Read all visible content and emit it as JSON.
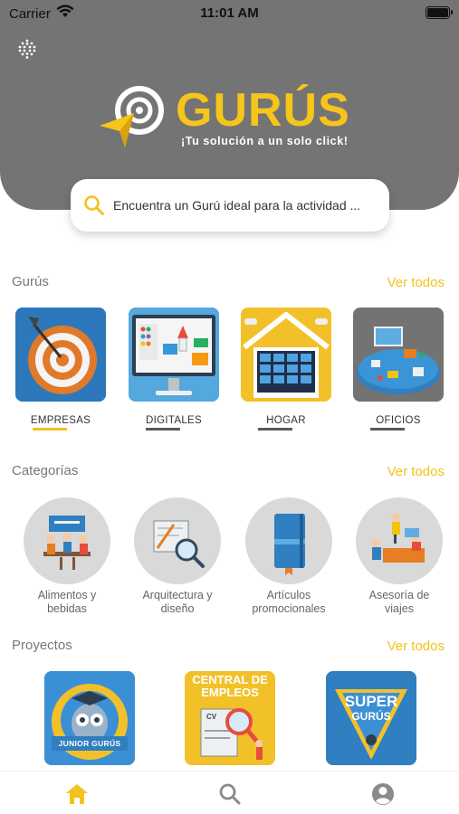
{
  "status_bar": {
    "carrier": "Carrier",
    "time": "11:01 AM"
  },
  "brand": {
    "name": "GURÚS",
    "tagline": "¡Tu solución a un solo click!"
  },
  "search": {
    "placeholder": "Encuentra un Gurú ideal para la actividad ..."
  },
  "sections": {
    "gurus": {
      "title": "Gurús",
      "see_all": "Ver todos"
    },
    "categories": {
      "title": "Categorías",
      "see_all": "Ver todos"
    },
    "projects": {
      "title": "Proyectos",
      "see_all": "Ver todos"
    }
  },
  "gurus": [
    {
      "label": "EMPRESAS",
      "selected": true
    },
    {
      "label": "DIGITALES",
      "selected": false
    },
    {
      "label": "HOGAR",
      "selected": false
    },
    {
      "label": "OFICIOS",
      "selected": false
    }
  ],
  "categories": [
    {
      "line1": "Alimentos y",
      "line2": "bebidas"
    },
    {
      "line1": "Arquitectura y",
      "line2": "diseño"
    },
    {
      "line1": "Artículos",
      "line2": "promocionales"
    },
    {
      "line1": "Asesoría de",
      "line2": "viajes"
    }
  ],
  "projects": [
    {
      "caption": "JUNIOR GURÚS"
    },
    {
      "title_line1": "CENTRAL DE",
      "title_line2": "EMPLEOS",
      "doc": "CV"
    },
    {
      "title_line1": "SUPER",
      "title_line2": "GURÚS"
    }
  ],
  "tab_bar": {
    "items": [
      {
        "icon": "home-icon",
        "active": true
      },
      {
        "icon": "search-icon",
        "active": false
      },
      {
        "icon": "profile-icon",
        "active": false
      }
    ]
  },
  "colors": {
    "accent": "#f3c21c",
    "header_gray": "#747474",
    "tab_inactive": "#8a8a8a",
    "bar_inactive": "#5a5a5a"
  }
}
